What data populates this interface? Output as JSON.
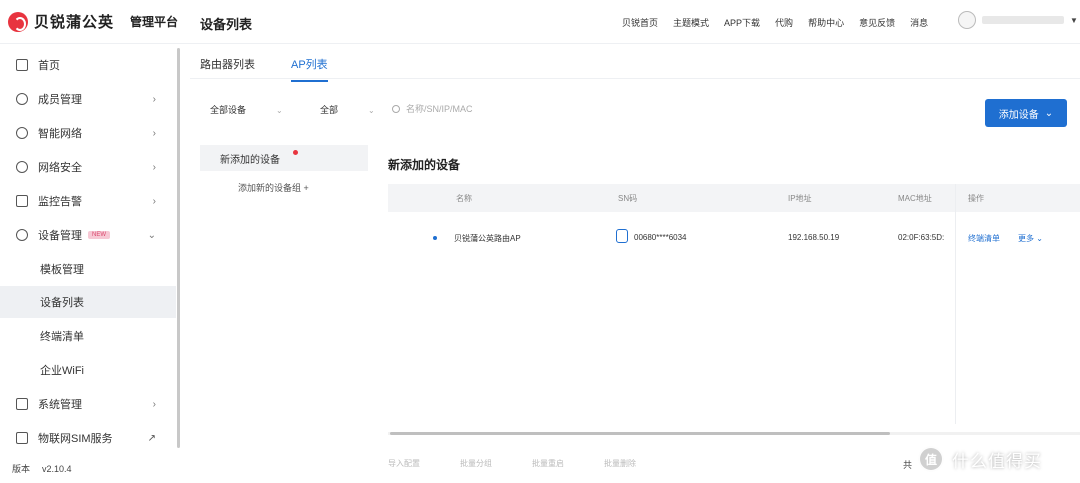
{
  "brand": {
    "name": "贝锐蒲公英",
    "sub": "管理平台"
  },
  "page_title": "设备列表",
  "top_nav": [
    "贝锐首页",
    "主题模式",
    "APP下载",
    "代购",
    "帮助中心",
    "意见反馈",
    "消息"
  ],
  "user": {
    "name": ""
  },
  "sidebar": {
    "items": [
      {
        "label": "首页",
        "chev": ""
      },
      {
        "label": "成员管理",
        "chev": "›"
      },
      {
        "label": "智能网络",
        "chev": "›"
      },
      {
        "label": "网络安全",
        "chev": "›"
      },
      {
        "label": "监控告警",
        "chev": "›"
      },
      {
        "label": "设备管理",
        "chev": "⌄"
      }
    ],
    "sub_items": [
      "模板管理",
      "设备列表",
      "终端清单",
      "企业WiFi"
    ],
    "items_after": [
      {
        "label": "系统管理",
        "chev": "›"
      },
      {
        "label": "物联网SIM服务",
        "chev": "↗"
      }
    ],
    "new_tag": "NEW",
    "version_label": "版本",
    "version_value": "v2.10.4"
  },
  "tabs": [
    "路由器列表",
    "AP列表"
  ],
  "filters": {
    "group": "全部设备",
    "status": "全部",
    "search_placeholder": "名称/SN/IP/MAC"
  },
  "add_button": "添加设备",
  "left_panel": {
    "item": "新添加的设备",
    "sub": "添加新的设备组 +"
  },
  "section_title": "新添加的设备",
  "table": {
    "headers": [
      "名称",
      "SN码",
      "IP地址",
      "MAC地址",
      "操作"
    ],
    "rows": [
      {
        "name": "贝锐蒲公英路由AP",
        "sn": "00680****6034",
        "ip": "192.168.50.19",
        "mac": "02:0F:63:5D:",
        "action1": "终端清单",
        "action2": "更多"
      }
    ]
  },
  "footer": {
    "buttons": [
      "导入配置",
      "批量分组",
      "批量重启",
      "批量删除"
    ],
    "right": "共"
  },
  "watermark": {
    "logo": "值",
    "text": "什么值得买"
  }
}
